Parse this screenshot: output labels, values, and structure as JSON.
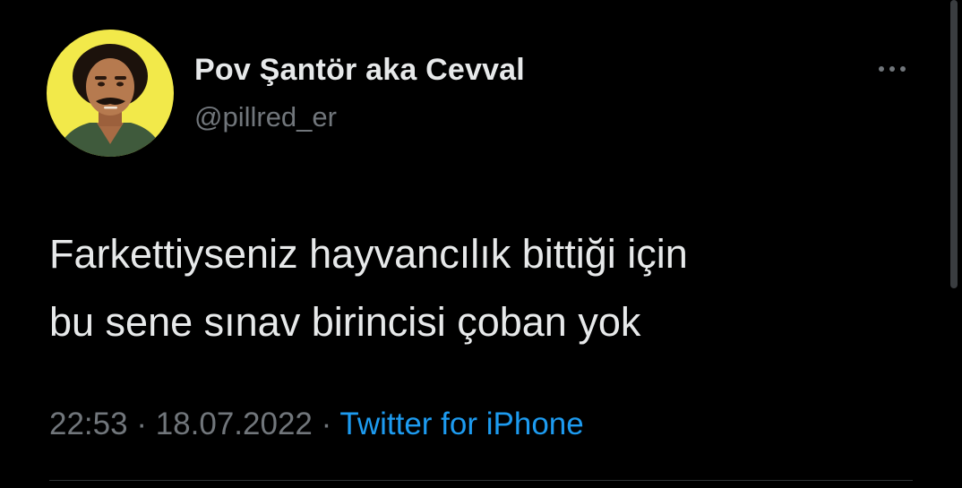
{
  "tweet": {
    "author": {
      "display_name": "Pov Şantör aka Cevval",
      "handle": "@pillred_er"
    },
    "text_lines": [
      "Farkettiyseniz hayvancılık bittiği için",
      "bu sene sınav birincisi çoban yok"
    ],
    "time": "22:53",
    "separator": "·",
    "date": "18.07.2022",
    "source": "Twitter for iPhone"
  },
  "icons": {
    "more": "more-horizontal-icon"
  },
  "colors": {
    "background": "#000000",
    "primary_text": "#e7e9ea",
    "secondary_text": "#71767b",
    "link": "#1d9bf0",
    "avatar_background": "#f2e94a"
  }
}
